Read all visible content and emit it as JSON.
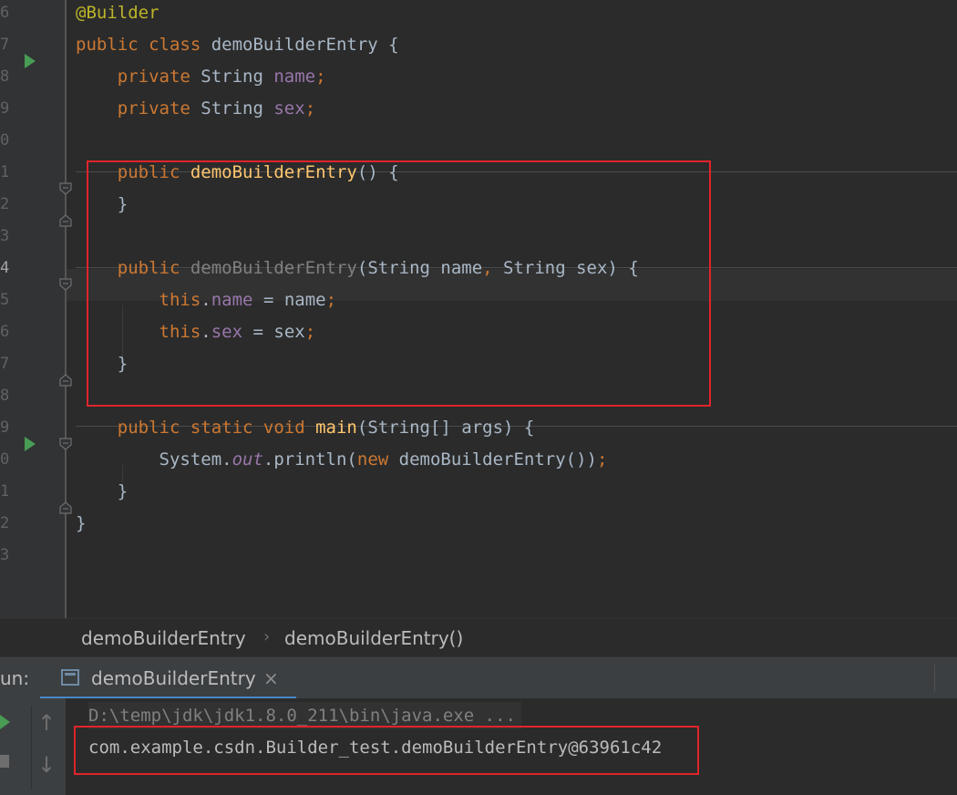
{
  "editor": {
    "line_numbers": [
      "6",
      "7",
      "8",
      "9",
      "0",
      "1",
      "2",
      "3",
      "4",
      "5",
      "6",
      "7",
      "8",
      "9",
      "0",
      "1",
      "2",
      "3"
    ],
    "current_line_index": 8,
    "lines": [
      [
        {
          "t": "@Builder",
          "c": "ann"
        }
      ],
      [
        {
          "t": "public class ",
          "c": "kw"
        },
        {
          "t": "demoBuilderEntry {",
          "c": "plain"
        }
      ],
      [
        {
          "t": "    private ",
          "c": "kw"
        },
        {
          "t": "String ",
          "c": "plain"
        },
        {
          "t": "name",
          "c": "field"
        },
        {
          "t": ";",
          "c": "kw"
        }
      ],
      [
        {
          "t": "    private ",
          "c": "kw"
        },
        {
          "t": "String ",
          "c": "plain"
        },
        {
          "t": "sex",
          "c": "field"
        },
        {
          "t": ";",
          "c": "kw"
        }
      ],
      [],
      [
        {
          "t": "    public ",
          "c": "kw"
        },
        {
          "t": "demoBuilderEntry",
          "c": "method"
        },
        {
          "t": "() {",
          "c": "plain"
        }
      ],
      [
        {
          "t": "    }",
          "c": "plain"
        }
      ],
      [],
      [
        {
          "t": "    public ",
          "c": "kw"
        },
        {
          "t": "demoBuilderEntry",
          "c": "unused"
        },
        {
          "t": "(String name",
          "c": "plain"
        },
        {
          "t": ", ",
          "c": "kw"
        },
        {
          "t": "String sex) {",
          "c": "plain"
        }
      ],
      [
        {
          "t": "        this",
          "c": "kw"
        },
        {
          "t": ".",
          "c": "plain"
        },
        {
          "t": "name",
          "c": "field"
        },
        {
          "t": " = name",
          "c": "plain"
        },
        {
          "t": ";",
          "c": "kw"
        }
      ],
      [
        {
          "t": "        this",
          "c": "kw"
        },
        {
          "t": ".",
          "c": "plain"
        },
        {
          "t": "sex",
          "c": "field"
        },
        {
          "t": " = sex",
          "c": "plain"
        },
        {
          "t": ";",
          "c": "kw"
        }
      ],
      [
        {
          "t": "    }",
          "c": "plain"
        }
      ],
      [],
      [
        {
          "t": "    public static void ",
          "c": "kw"
        },
        {
          "t": "main",
          "c": "method"
        },
        {
          "t": "(String[] args) {",
          "c": "plain"
        }
      ],
      [
        {
          "t": "        System.",
          "c": "plain"
        },
        {
          "t": "out",
          "c": "static"
        },
        {
          "t": ".println(",
          "c": "plain"
        },
        {
          "t": "new ",
          "c": "kw"
        },
        {
          "t": "demoBuilderEntry())",
          "c": "plain"
        },
        {
          "t": ";",
          "c": "kw"
        }
      ],
      [
        {
          "t": "    }",
          "c": "plain"
        }
      ],
      [
        {
          "t": "}",
          "c": "plain"
        }
      ],
      []
    ]
  },
  "breadcrumb": {
    "class_name": "demoBuilderEntry",
    "separator": "›",
    "method_name": "demoBuilderEntry()"
  },
  "run_panel": {
    "label": "un:",
    "tab_label": "demoBuilderEntry",
    "close_glyph": "×",
    "console": {
      "command": "D:\\temp\\jdk\\jdk1.8.0_211\\bin\\java.exe ...",
      "output": "com.example.csdn.Builder_test.demoBuilderEntry@63961c42"
    }
  },
  "colors": {
    "keyword": "#cc7832",
    "annotation": "#bbb529",
    "field": "#9876aa",
    "method": "#ffc66d",
    "plain": "#a9b7c6",
    "highlight_box": "#e0242a"
  }
}
